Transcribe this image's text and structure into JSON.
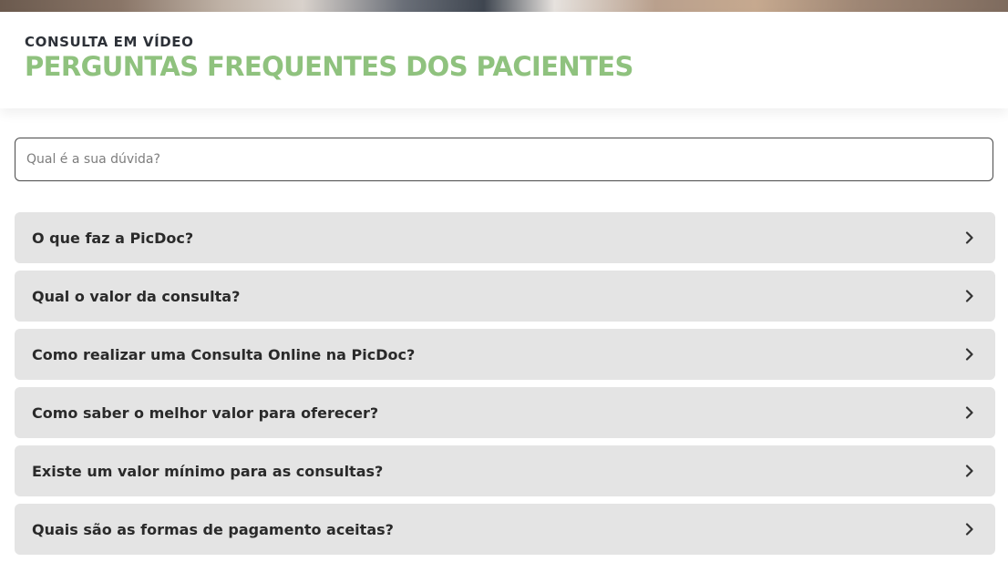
{
  "header": {
    "subtitle": "CONSULTA EM VÍDEO",
    "title": "PERGUNTAS FREQUENTES DOS PACIENTES",
    "title_color": "#8fc27e"
  },
  "search": {
    "placeholder": "Qual é a sua dúvida?"
  },
  "faq": {
    "items": [
      {
        "question": "O que faz a PicDoc?",
        "icon": "chevron-right-icon"
      },
      {
        "question": "Qual o valor da consulta?",
        "icon": "chevron-right-icon"
      },
      {
        "question": "Como realizar uma Consulta Online na PicDoc?",
        "icon": "chevron-right-icon"
      },
      {
        "question": "Como saber o melhor valor para oferecer?",
        "icon": "chevron-right-icon"
      },
      {
        "question": "Existe um valor mínimo para as consultas?",
        "icon": "chevron-right-icon"
      },
      {
        "question": "Quais são as formas de pagamento aceitas?",
        "icon": "chevron-right-icon"
      }
    ]
  }
}
